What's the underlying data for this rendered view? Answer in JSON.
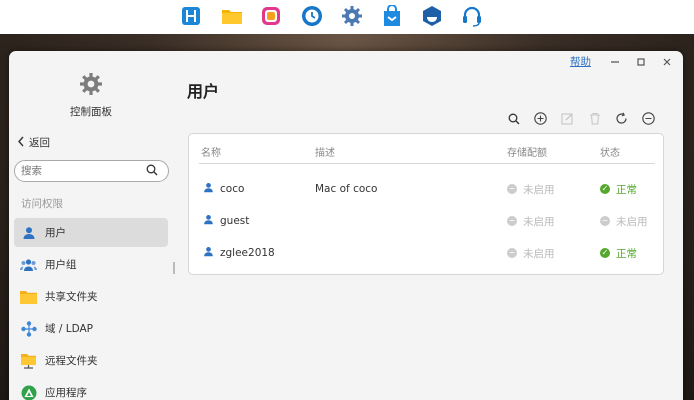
{
  "sidebar": {
    "title": "控制面板",
    "back_label": "返回",
    "search_placeholder": "搜索",
    "section_label": "访问权限",
    "items": [
      {
        "label": "用户",
        "icon": "user-icon",
        "active": true
      },
      {
        "label": "用户组",
        "icon": "group-icon"
      },
      {
        "label": "共享文件夹",
        "icon": "folder-icon"
      },
      {
        "label": "域 / LDAP",
        "icon": "domain-icon"
      },
      {
        "label": "远程文件夹",
        "icon": "remote-folder-icon"
      },
      {
        "label": "应用程序",
        "icon": "app-icon"
      }
    ]
  },
  "window": {
    "help_label": "帮助"
  },
  "main": {
    "title": "用户",
    "columns": [
      "名称",
      "描述",
      "存储配额",
      "状态"
    ],
    "rows": [
      {
        "name": "coco",
        "description": "Mac of coco",
        "quota": "未启用",
        "status": "正常",
        "status_ok": true
      },
      {
        "name": "guest",
        "description": "",
        "quota": "未启用",
        "status": "未启用",
        "status_ok": false
      },
      {
        "name": "zglee2018",
        "description": "",
        "quota": "未启用",
        "status": "正常",
        "status_ok": true
      }
    ]
  },
  "colors": {
    "accent": "#2f72c4",
    "ok": "#54a82d",
    "disabled": "#bbbbbb"
  }
}
